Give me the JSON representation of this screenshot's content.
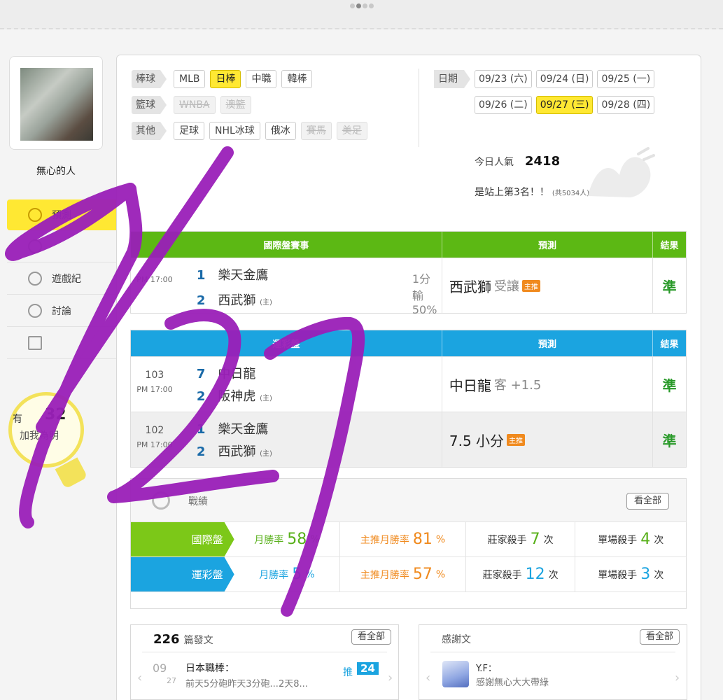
{
  "pager": {
    "dots": 4,
    "active": 2
  },
  "profile": {
    "username": "無心的人"
  },
  "sidebar": {
    "items": [
      {
        "label": "預測",
        "icon": "target-icon",
        "active": true
      },
      {
        "label": "",
        "icon": "list-icon"
      },
      {
        "label": "遊戲紀",
        "icon": "circle-icon"
      },
      {
        "label": "討論",
        "icon": "chat-icon"
      },
      {
        "label": "",
        "icon": "star-icon"
      }
    ],
    "fans": {
      "prefix": "有",
      "count": "32",
      "link": "加我為明"
    }
  },
  "filters": {
    "rows": [
      {
        "tag": "棒球",
        "buttons": [
          {
            "label": "MLB"
          },
          {
            "label": "日棒",
            "selected": true
          },
          {
            "label": "中職"
          },
          {
            "label": "韓棒"
          }
        ]
      },
      {
        "tag": "籃球",
        "buttons": [
          {
            "label": "WNBA",
            "disabled": true
          },
          {
            "label": "澳籃",
            "disabled": true
          }
        ]
      },
      {
        "tag": "其他",
        "buttons": [
          {
            "label": "足球"
          },
          {
            "label": "NHL冰球"
          },
          {
            "label": "俄冰"
          },
          {
            "label": "賽馬",
            "disabled": true
          },
          {
            "label": "美足",
            "disabled": true
          }
        ]
      }
    ]
  },
  "dates": {
    "tag": "日期",
    "row1": [
      "09/23 (六)",
      "09/24 (日)",
      "09/25 (一)"
    ],
    "row2": [
      "09/26 (二)",
      "09/27 (三)",
      "09/28 (四)"
    ],
    "selected": "09/27 (三)"
  },
  "popularity": {
    "label": "今日人氣",
    "value": "2418",
    "rank_text": "是站上第3名！！",
    "rank_total": "(共5034人)"
  },
  "intl_table": {
    "headers": [
      "國際盤賽事",
      "預測",
      "結果"
    ],
    "rows": [
      {
        "code": "",
        "time": "PM 17:00",
        "team1_no": "1",
        "team1": "樂天金鷹",
        "team2_no": "2",
        "team2": "西武獅",
        "home_mark": "(主)",
        "odds": "1分輸50%",
        "pick": "西武獅",
        "pick_sub": "受讓",
        "badge": "主推",
        "result": "準"
      }
    ]
  },
  "lottery_table": {
    "headers": [
      "運彩盤",
      "預測",
      "結果"
    ],
    "rows": [
      {
        "code": "103",
        "time": "PM 17:00",
        "team1_no": "7",
        "team1": "中日龍",
        "team2_no": "2",
        "team2": "阪神虎",
        "home_mark": "(主)",
        "pick": "中日龍",
        "pick_sub": "客 +1.5",
        "badge": "",
        "result": "準"
      },
      {
        "code": "102",
        "time": "PM 17:00",
        "team1_no": "1",
        "team1": "樂天金鷹",
        "team2_no": "2",
        "team2": "西武獅",
        "home_mark": "(主)",
        "pick": "7.5 小分",
        "pick_sub": "",
        "badge": "主推",
        "result": "準"
      }
    ]
  },
  "record": {
    "title": "戰績",
    "view_all": "看全部",
    "rows": [
      {
        "label": "國際盤",
        "color": "#7cc818",
        "month_label": "月勝率",
        "month_value": "58",
        "main_label": "主推月勝率",
        "main_value": "81",
        "pct": "%",
        "banker_label": "莊家殺手",
        "banker_value": "7",
        "single_label": "單場殺手",
        "single_value": "4",
        "times": "次"
      },
      {
        "label": "運彩盤",
        "color": "#1ba4e0",
        "month_label": "月勝率",
        "month_value": "5",
        "main_label": "主推月勝率",
        "main_value": "57",
        "pct": "%",
        "banker_label": "莊家殺手",
        "banker_value": "12",
        "single_label": "單場殺手",
        "single_value": "3",
        "times": "次"
      }
    ]
  },
  "posts": {
    "count": "226",
    "label": "篇發文",
    "view_all": "看全部",
    "date_md": "09",
    "date_d": "27",
    "title": "日本職棒：",
    "snippet": "前天5分砲昨天3分砲...2天8...",
    "push_label": "推",
    "push_count": "24"
  },
  "thanks": {
    "label": "感謝文",
    "view_all": "看全部",
    "name": "Y.F：",
    "message": "感謝無心大大帶綠"
  },
  "overlay": {
    "handwriting": "1/27",
    "color": "#9a1fb8"
  }
}
